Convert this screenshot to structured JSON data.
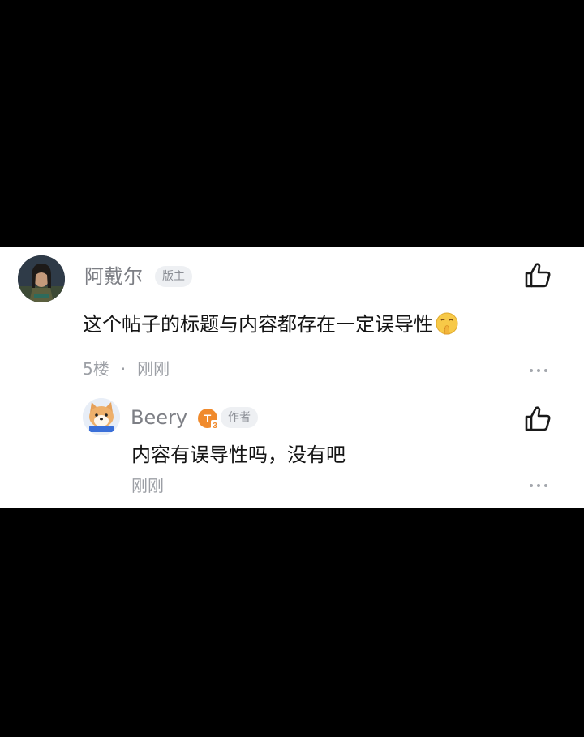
{
  "comment": {
    "avatar_icon": "avatar-warrior-icon",
    "author": "阿戴尔",
    "role_badge": "版主",
    "text": "这个帖子的标题与内容都存在一定误导性",
    "emoji_icon": "shushing-face-emoji-icon",
    "floor": "5楼",
    "separator": "·",
    "time": "刚刚"
  },
  "reply": {
    "avatar_icon": "avatar-shiba-dog-icon",
    "author": "Beery",
    "level_badge": "T",
    "level_number": "3",
    "role_badge": "作者",
    "text": "内容有误导性吗，没有吧",
    "time": "刚刚"
  },
  "colors": {
    "background": "#000000",
    "panel": "#ffffff",
    "level_badge": "#f08a2c"
  }
}
